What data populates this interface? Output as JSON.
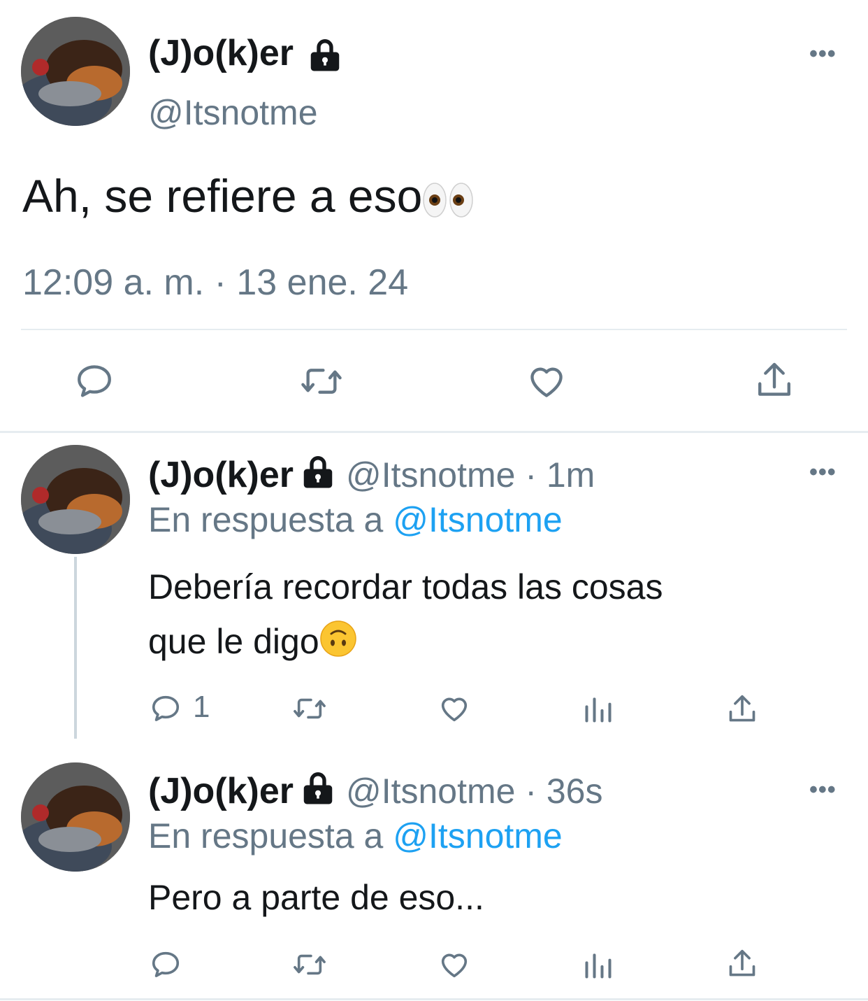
{
  "main_tweet": {
    "display_name": "(J)o(k)er",
    "handle": "@Itsnotme",
    "text": "Ah, se refiere a eso",
    "timestamp": "12:09 a. m. · 13 ene. 24",
    "more_label": "•••"
  },
  "replies": [
    {
      "display_name": "(J)o(k)er",
      "handle_time": "@Itsnotme · 1m",
      "reply_prefix": "En respuesta a",
      "reply_to": "@Itsnotme",
      "text_line1": "Debería recordar todas las cosas",
      "text_line2": "que le digo",
      "reply_count": "1",
      "more_label": "•••"
    },
    {
      "display_name": "(J)o(k)er",
      "handle_time": "@Itsnotme · 36s",
      "reply_prefix": "En respuesta a",
      "reply_to": "@Itsnotme",
      "text": "Pero a parte de eso...",
      "more_label": "•••"
    }
  ],
  "icons": [
    "lock-icon",
    "more-icon",
    "reply-icon",
    "retweet-icon",
    "like-icon",
    "share-icon",
    "analytics-icon",
    "eyes-emoji",
    "upside-down-face-emoji"
  ],
  "colors": {
    "text": "#14171a",
    "secondary": "#657786",
    "link": "#1da1f2",
    "divider": "#e6ecf0"
  }
}
